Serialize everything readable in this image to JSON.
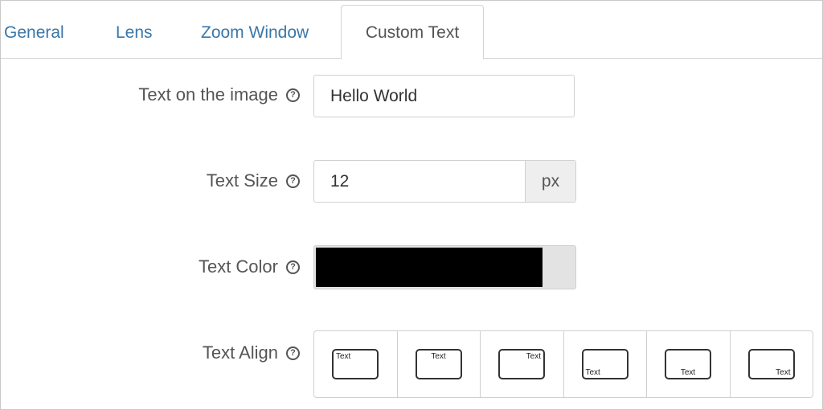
{
  "tabs": [
    {
      "label": "General"
    },
    {
      "label": "Lens"
    },
    {
      "label": "Zoom Window"
    },
    {
      "label": "Custom Text",
      "active": true
    }
  ],
  "fields": {
    "text_on_image": {
      "label": "Text on the image",
      "value": "Hello World"
    },
    "text_size": {
      "label": "Text Size",
      "value": "12",
      "unit": "px"
    },
    "text_color": {
      "label": "Text Color",
      "value": "#000000"
    },
    "text_align": {
      "label": "Text Align",
      "options": [
        {
          "position": "top-left",
          "text": "Text"
        },
        {
          "position": "top-center",
          "text": "Text"
        },
        {
          "position": "top-right",
          "text": "Text"
        },
        {
          "position": "bottom-left",
          "text": "Text"
        },
        {
          "position": "bottom-center",
          "text": "Text"
        },
        {
          "position": "bottom-right",
          "text": "Text"
        }
      ]
    }
  },
  "help_icon_glyph": "?",
  "icons": [
    "help-icon"
  ]
}
